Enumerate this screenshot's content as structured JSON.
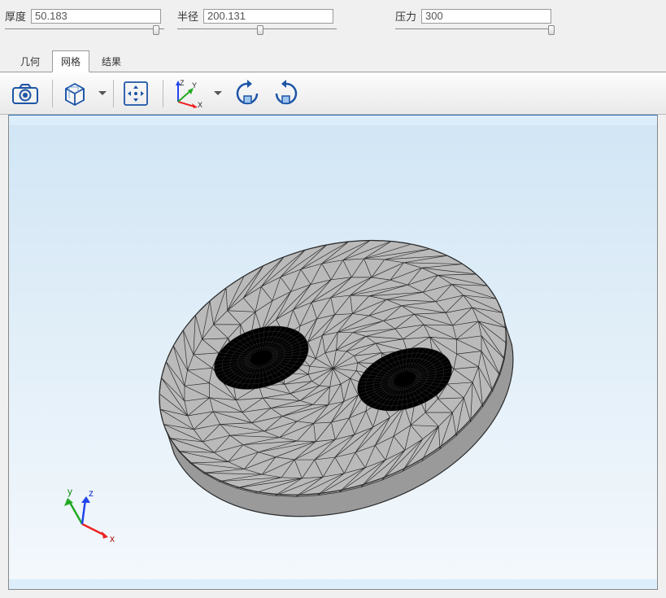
{
  "params": {
    "thickness": {
      "label": "厚度",
      "value": "50.183",
      "slider_pos": 0.95
    },
    "radius": {
      "label": "半径",
      "value": "200.131",
      "slider_pos": 0.52
    },
    "pressure": {
      "label": "压力",
      "value": "300",
      "slider_pos": 0.98
    }
  },
  "tabs": {
    "geometry": "几何",
    "mesh": "网格",
    "results": "结果",
    "active": "mesh"
  },
  "toolbar": {
    "camera": "camera-icon",
    "cube": "cube-view-icon",
    "pan": "pan-icon",
    "axis": "axis-icon",
    "rotate_cw": "rotate-cw-icon",
    "rotate_ccw": "rotate-ccw-icon"
  },
  "viewport": {
    "axes": {
      "x_label": "x",
      "y_label": "y",
      "z_label": "z"
    },
    "toolbar_axes": {
      "x": "X",
      "y": "Y",
      "z": "Z"
    }
  },
  "colors": {
    "toolbar_blue": "#1d55a6",
    "mesh_fill": "#bababa",
    "mesh_edge": "#2b2b2b",
    "axis_x": "#e22",
    "axis_y": "#2a2",
    "axis_z": "#24e"
  }
}
